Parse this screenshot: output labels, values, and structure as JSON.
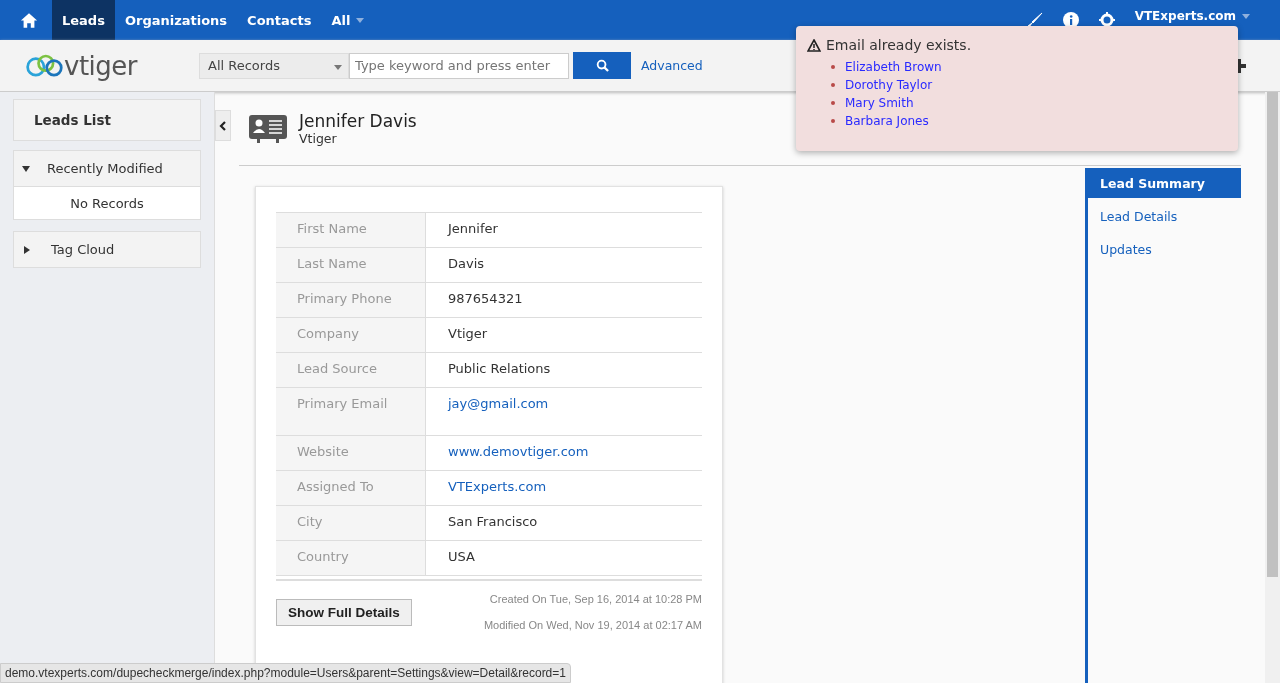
{
  "top_nav": {
    "items": [
      {
        "label": "Leads",
        "selected": true
      },
      {
        "label": "Organizations",
        "selected": false
      },
      {
        "label": "Contacts",
        "selected": false
      },
      {
        "label": "All",
        "selected": false
      }
    ],
    "user": "VTExperts.com"
  },
  "logo": "vtiger",
  "search": {
    "filter": "All Records",
    "placeholder": "Type keyword and press enter",
    "advanced": "Advanced"
  },
  "sidebar": {
    "title": "Leads List",
    "sections": [
      {
        "label": "Recently Modified",
        "expanded": true,
        "empty_text": "No Records"
      },
      {
        "label": "Tag Cloud",
        "expanded": false
      }
    ]
  },
  "record": {
    "name": "Jennifer Davis",
    "company": "Vtiger"
  },
  "fields": [
    {
      "label": "First Name",
      "value": "Jennifer",
      "kind": "text"
    },
    {
      "label": "Last Name",
      "value": "Davis",
      "kind": "text"
    },
    {
      "label": "Primary Phone",
      "value": "987654321",
      "kind": "text"
    },
    {
      "label": "Company",
      "value": "Vtiger",
      "kind": "text"
    },
    {
      "label": "Lead Source",
      "value": "Public Relations",
      "kind": "text"
    },
    {
      "label": "Primary Email",
      "value": "jay@gmail.com",
      "kind": "email"
    },
    {
      "label": "Website",
      "value": "www.demovtiger.com",
      "kind": "link"
    },
    {
      "label": "Assigned To",
      "value": "VTExperts.com",
      "kind": "link"
    },
    {
      "label": "City",
      "value": "San Francisco",
      "kind": "text"
    },
    {
      "label": "Country",
      "value": "USA",
      "kind": "text"
    }
  ],
  "show_full_details": "Show Full Details",
  "created": "Created On Tue, Sep 16, 2014 at 10:28 PM",
  "modified": "Modified On Wed, Nov 19, 2014 at 02:17 AM",
  "right_nav": [
    {
      "label": "Lead Summary",
      "selected": true
    },
    {
      "label": "Lead Details",
      "selected": false
    },
    {
      "label": "Updates",
      "selected": false
    }
  ],
  "alert": {
    "title": "Email already exists.",
    "duplicates": [
      "Elizabeth Brown",
      "Dorothy Taylor",
      "Mary Smith",
      "Barbara Jones"
    ]
  },
  "status_bar": "demo.vtexperts.com/dupecheckmerge/index.php?module=Users&parent=Settings&view=Detail&record=1"
}
